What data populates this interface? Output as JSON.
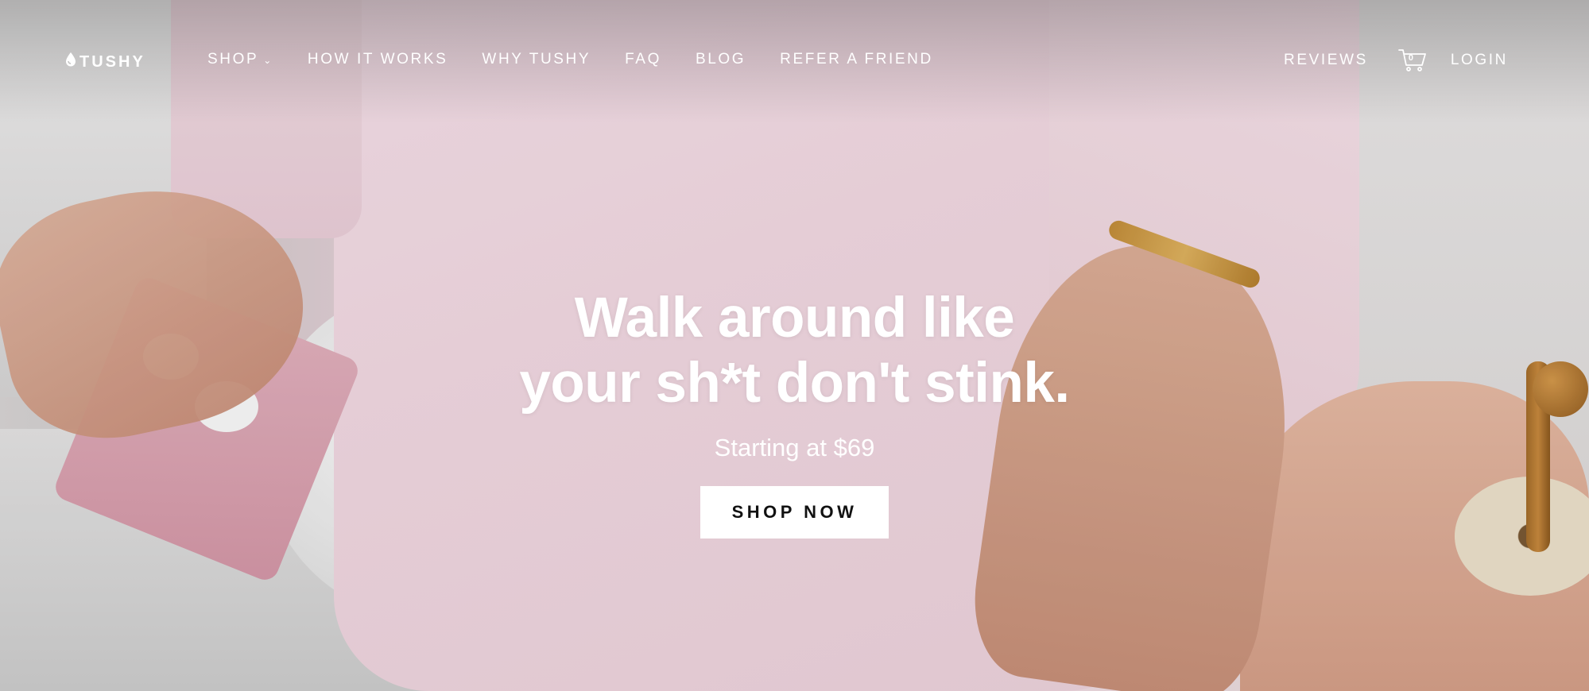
{
  "brand": {
    "name": "TUSHY",
    "logo_icon": "droplet-icon"
  },
  "nav": {
    "items": [
      {
        "label": "SHOP",
        "has_dropdown": true
      },
      {
        "label": "HOW IT WORKS"
      },
      {
        "label": "WHY TUSHY"
      },
      {
        "label": "FAQ"
      },
      {
        "label": "BLOG"
      },
      {
        "label": "REFER A FRIEND"
      }
    ],
    "dropdown_icon": "chevron-down-icon"
  },
  "nav_right": {
    "reviews_label": "REVIEWS",
    "cart_icon": "shopping-cart-icon",
    "cart_count": "0",
    "login_label": "LOGIN"
  },
  "hero": {
    "headline_line1": "Walk around like",
    "headline_line2": "your sh*t don't stink.",
    "subtext": "Starting at $69",
    "cta_label": "SHOP NOW"
  },
  "colors": {
    "text": "#ffffff",
    "cta_background": "#ffffff",
    "cta_text": "#111111",
    "robe_pink": "#f4dae4"
  }
}
